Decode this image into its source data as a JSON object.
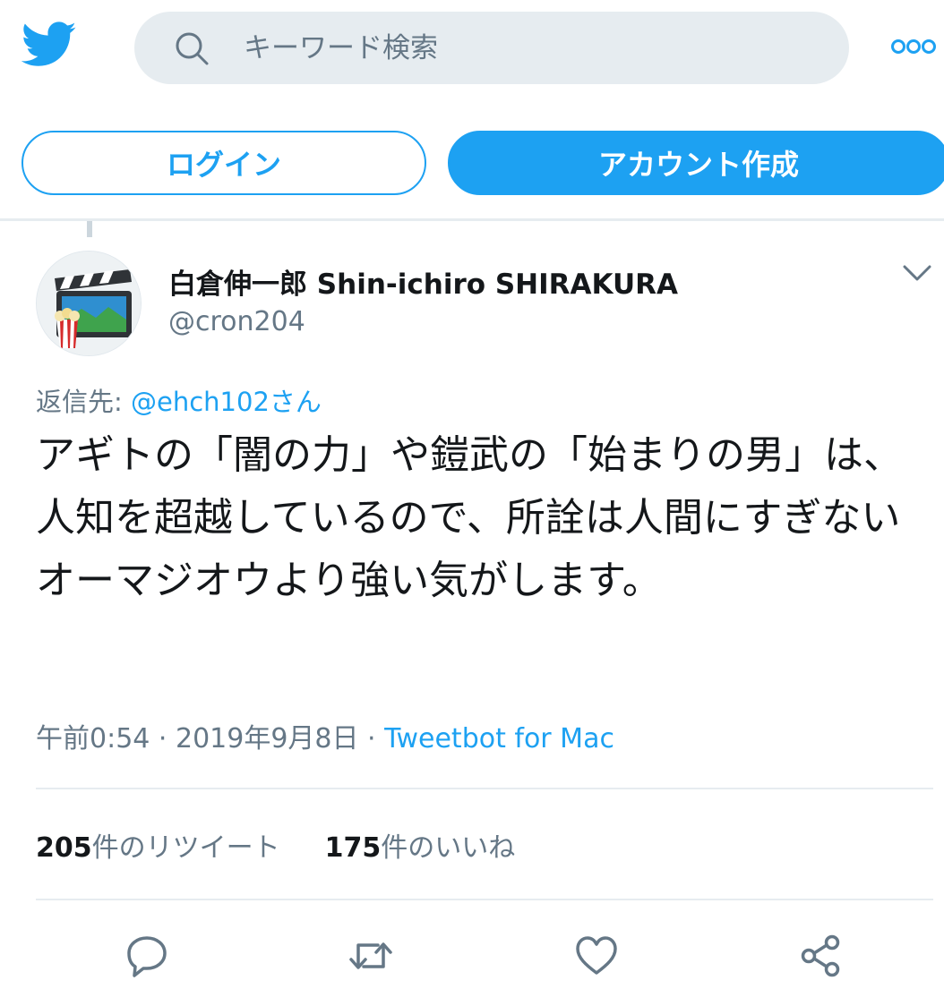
{
  "header": {
    "logo_icon": "twitter-bird-icon",
    "search": {
      "placeholder": "キーワード検索",
      "icon": "search-icon"
    },
    "more_icon": "more-icon"
  },
  "auth": {
    "login_label": "ログイン",
    "signup_label": "アカウント作成"
  },
  "tweet": {
    "author": {
      "display_name": "白倉伸一郎 Shin-ichiro SHIRAKURA",
      "handle": "@cron204"
    },
    "reply_prefix": "返信先: ",
    "reply_mention": "@ehch102さん",
    "text": "アギトの「闇の力」や鎧武の「始まりの男」は、人知を超越しているので、所詮は人間にすぎないオーマジオウより強い気がします。",
    "time": "午前0:54",
    "date": "2019年9月8日",
    "separator": " · ",
    "source": "Tweetbot for Mac",
    "stats": {
      "retweet_count": "205",
      "retweet_label": "件のリツイート",
      "like_count": "175",
      "like_label": "件のいいね"
    },
    "actions": [
      "reply-icon",
      "retweet-icon",
      "like-icon",
      "share-icon"
    ]
  },
  "colors": {
    "accent": "#1da1f2",
    "muted": "#657786",
    "text": "#14171a",
    "divider": "#e6ecf0",
    "search_bg": "#e6ecf0"
  }
}
